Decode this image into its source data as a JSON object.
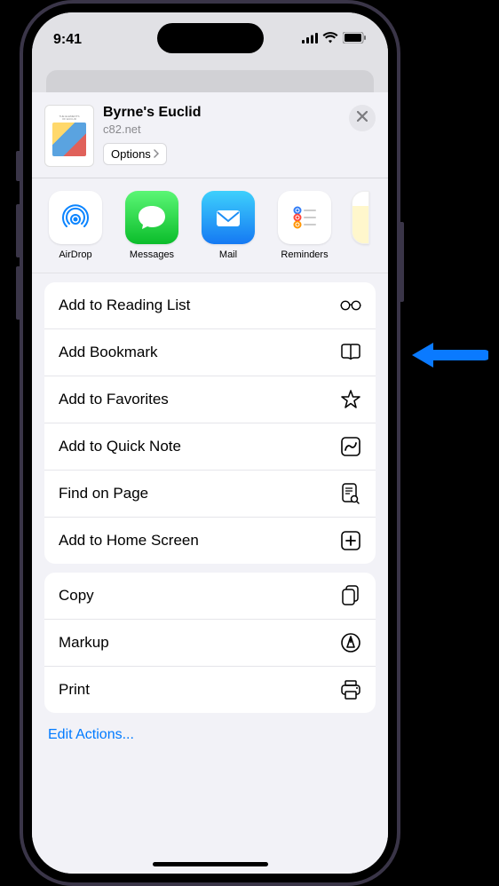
{
  "status": {
    "time": "9:41"
  },
  "header": {
    "title": "Byrne's Euclid",
    "subtitle": "c82.net",
    "options_label": "Options"
  },
  "apps": [
    {
      "name": "AirDrop"
    },
    {
      "name": "Messages"
    },
    {
      "name": "Mail"
    },
    {
      "name": "Reminders"
    }
  ],
  "actions_group1": [
    {
      "label": "Add to Reading List",
      "icon": "glasses"
    },
    {
      "label": "Add Bookmark",
      "icon": "book"
    },
    {
      "label": "Add to Favorites",
      "icon": "star"
    },
    {
      "label": "Add to Quick Note",
      "icon": "quicknote"
    },
    {
      "label": "Find on Page",
      "icon": "doc-search"
    },
    {
      "label": "Add to Home Screen",
      "icon": "plus-square"
    }
  ],
  "actions_group2": [
    {
      "label": "Copy",
      "icon": "doc-on-doc"
    },
    {
      "label": "Markup",
      "icon": "markup"
    },
    {
      "label": "Print",
      "icon": "printer"
    }
  ],
  "edit_actions_label": "Edit Actions..."
}
